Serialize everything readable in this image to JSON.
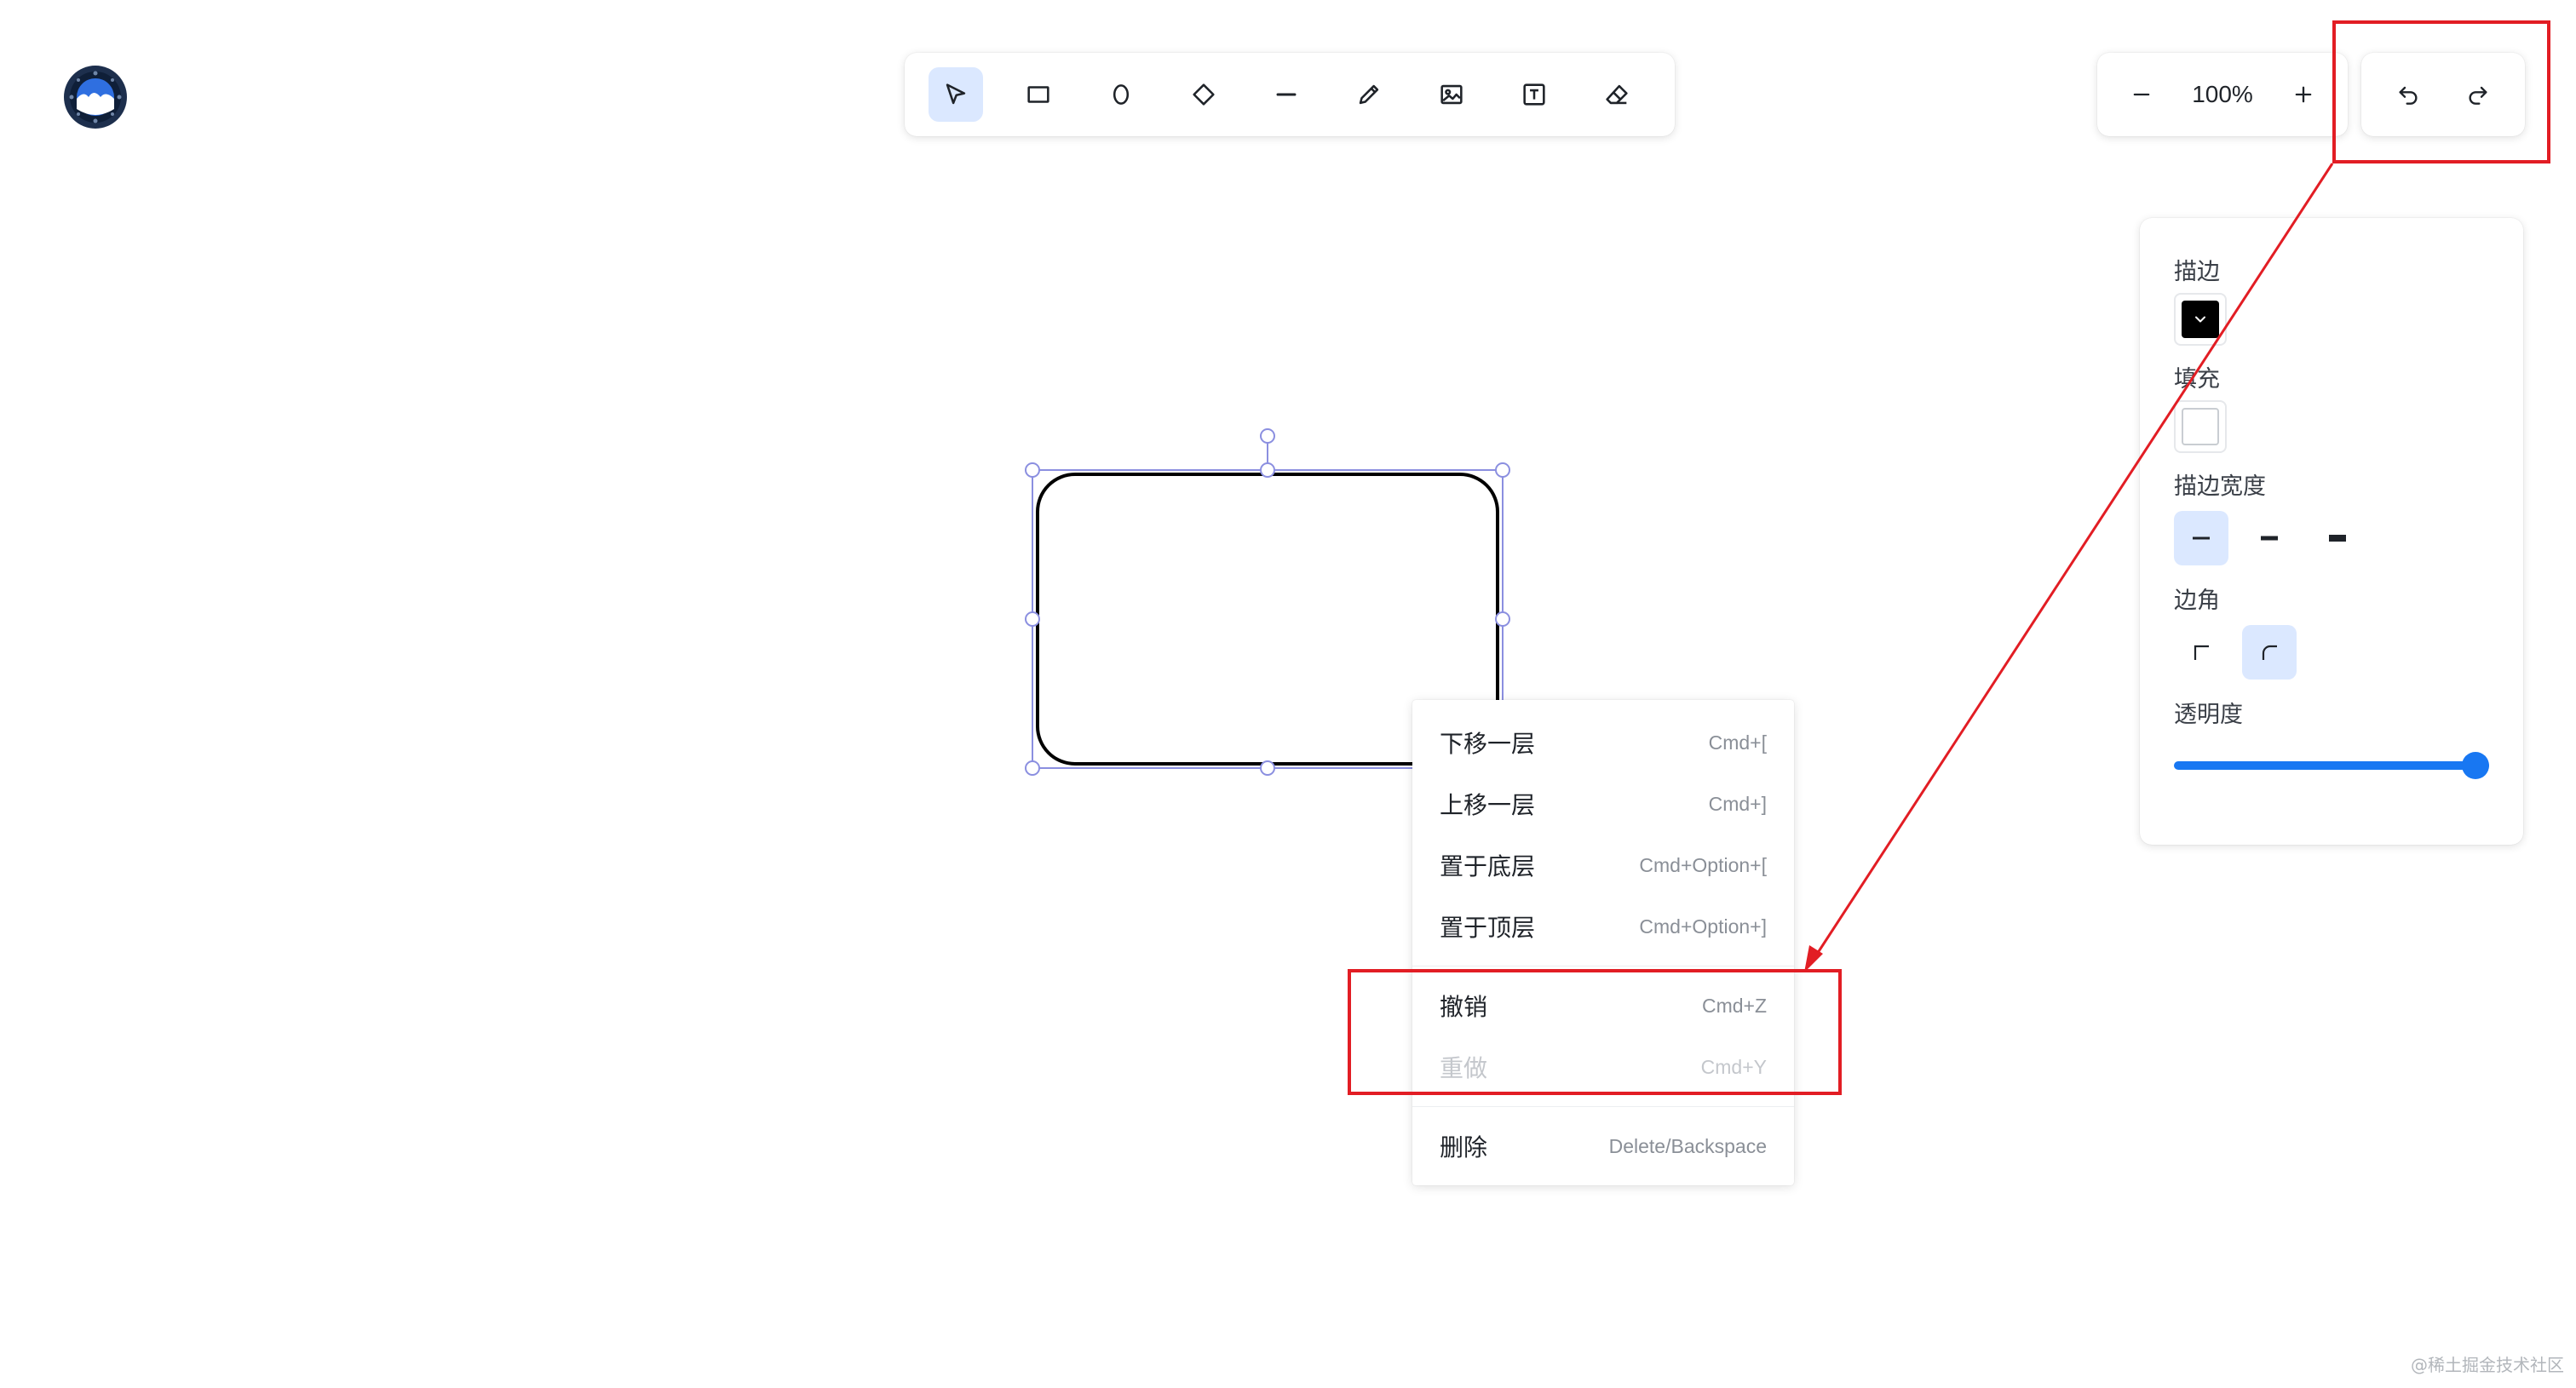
{
  "colors": {
    "accent": "#1877f2",
    "active_bg": "#dbe8ff",
    "annotation_red": "#e21d24",
    "stroke_color": "#000000",
    "fill_color": "#ffffff"
  },
  "logo": {
    "icon": "moon-logo-icon"
  },
  "toolbar": {
    "tools": [
      {
        "name": "select",
        "icon": "cursor-arrow-icon",
        "active": true
      },
      {
        "name": "rectangle",
        "icon": "rectangle-icon",
        "active": false
      },
      {
        "name": "ellipse",
        "icon": "ellipse-icon",
        "active": false
      },
      {
        "name": "diamond",
        "icon": "diamond-icon",
        "active": false
      },
      {
        "name": "line",
        "icon": "line-icon",
        "active": false
      },
      {
        "name": "pencil",
        "icon": "pencil-icon",
        "active": false
      },
      {
        "name": "image",
        "icon": "image-icon",
        "active": false
      },
      {
        "name": "text",
        "icon": "text-box-icon",
        "active": false
      },
      {
        "name": "eraser",
        "icon": "eraser-icon",
        "active": false
      }
    ]
  },
  "zoom": {
    "value": "100%",
    "minus_icon": "minus-icon",
    "plus_icon": "plus-icon"
  },
  "history": {
    "undo_icon": "undo-icon",
    "redo_icon": "redo-icon"
  },
  "props": {
    "stroke_label": "描边",
    "fill_label": "填充",
    "stroke_width_label": "描边宽度",
    "corner_label": "边角",
    "opacity_label": "透明度",
    "stroke_width_selected": 0,
    "corner_selected": 1,
    "opacity": 1.0
  },
  "context_menu": {
    "items": [
      {
        "label": "下移一层",
        "shortcut": "Cmd+[",
        "disabled": false
      },
      {
        "label": "上移一层",
        "shortcut": "Cmd+]",
        "disabled": false
      },
      {
        "label": "置于底层",
        "shortcut": "Cmd+Option+[",
        "disabled": false
      },
      {
        "label": "置于顶层",
        "shortcut": "Cmd+Option+]",
        "disabled": false
      },
      {
        "label": "撤销",
        "shortcut": "Cmd+Z",
        "disabled": false
      },
      {
        "label": "重做",
        "shortcut": "Cmd+Y",
        "disabled": true
      },
      {
        "label": "删除",
        "shortcut": "Delete/Backspace",
        "disabled": false
      }
    ]
  },
  "watermark": "@稀土掘金技术社区"
}
